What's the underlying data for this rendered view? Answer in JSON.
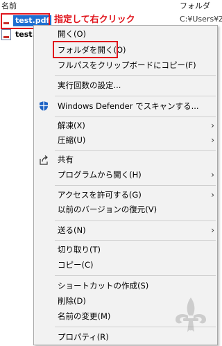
{
  "explorer": {
    "col_name": "名前",
    "col_folder": "フォルダ",
    "folder_path": "C:¥Users¥Z",
    "files": [
      {
        "label": "test.pdf",
        "selected": true
      },
      {
        "label": "test.p",
        "selected": false
      }
    ]
  },
  "annotation": "指定して右クリック",
  "menu": {
    "items": [
      {
        "label": "開く(O)"
      },
      {
        "label": "フォルダを開く(O)",
        "highlighted": true
      },
      {
        "label": "フルパスをクリップボードにコピー(F)"
      },
      {
        "label": "実行回数の設定..."
      },
      {
        "label": "Windows Defender でスキャンする...",
        "icon": "shield-icon"
      },
      {
        "label": "解凍(X)",
        "submenu": true
      },
      {
        "label": "圧縮(U)",
        "submenu": true
      },
      {
        "label": "共有",
        "icon": "share-icon"
      },
      {
        "label": "プログラムから開く(H)",
        "submenu": true
      },
      {
        "label": "アクセスを許可する(G)",
        "submenu": true
      },
      {
        "label": "以前のバージョンの復元(V)"
      },
      {
        "label": "送る(N)",
        "submenu": true
      },
      {
        "label": "切り取り(T)"
      },
      {
        "label": "コピー(C)"
      },
      {
        "label": "ショートカットの作成(S)"
      },
      {
        "label": "削除(D)"
      },
      {
        "label": "名前の変更(M)"
      },
      {
        "label": "プロパティ(R)"
      }
    ],
    "submenu_arrow": "›"
  },
  "colors": {
    "annotation_red": "#e0141c",
    "selection_blue": "#1f6fd1",
    "menu_bg": "#f2f2f2"
  }
}
